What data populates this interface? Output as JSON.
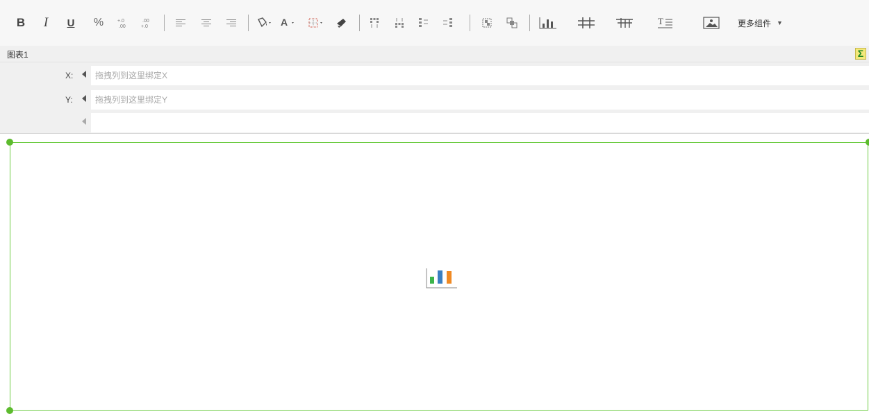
{
  "toolbar": {
    "bold_label": "B",
    "italic_label": "I",
    "underline_label": "U",
    "percent_label": "%",
    "more_label": "更多组件",
    "icons": [
      "bold-icon",
      "italic-icon",
      "underline-icon",
      "percent-icon",
      "increase-decimal-icon",
      "decrease-decimal-icon",
      "align-left-icon",
      "align-center-icon",
      "align-right-icon",
      "fill-color-icon",
      "font-color-icon",
      "border-icon",
      "format-painter-icon",
      "merge-vertical-icon",
      "split-vertical-icon",
      "insert-row-icon",
      "insert-column-icon",
      "group-icon",
      "ungroup-icon",
      "bar-chart-icon",
      "crosstab-icon",
      "table-icon",
      "text-icon",
      "image-icon"
    ]
  },
  "panel": {
    "title": "图表1",
    "sigma": "Σ"
  },
  "binding": {
    "x_label": "X:",
    "x_placeholder": "拖拽列到这里绑定X",
    "y_label": "Y:",
    "y_placeholder": "拖拽列到这里绑定Y"
  },
  "colors": {
    "selection_border": "#6ccb42",
    "chart_green": "#3cb44b",
    "chart_blue": "#3a7fc1",
    "chart_orange": "#f08a24"
  }
}
